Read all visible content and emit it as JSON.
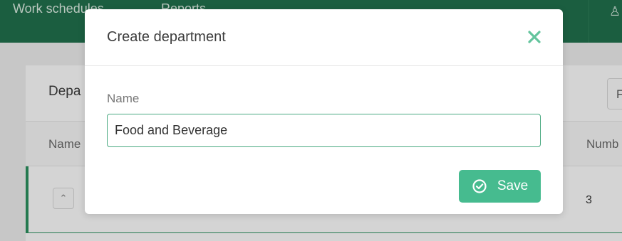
{
  "app": {
    "nav": {
      "work_schedules": "Work schedules",
      "reports": "Reports"
    },
    "card_title": "Depa",
    "filter_label": "F",
    "columns": {
      "name": "Name",
      "number": "Numb"
    },
    "row": {
      "count": "3"
    }
  },
  "modal": {
    "title": "Create department",
    "close_icon": "close-icon",
    "field_label": "Name",
    "name_value": "Food and Beverage",
    "save_label": "Save",
    "save_icon": "check-circle-icon"
  },
  "colors": {
    "topbar": "#1f6b49",
    "accent": "#46bb8f",
    "input_border": "#4aa981"
  }
}
